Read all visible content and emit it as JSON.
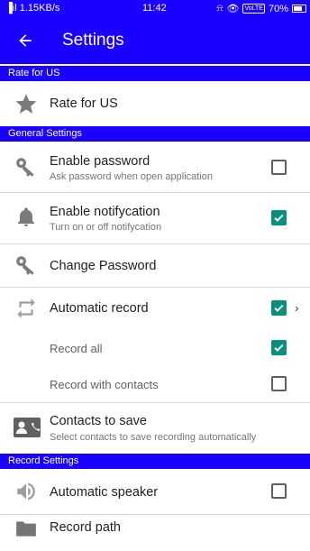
{
  "status_bar": {
    "signal": "▐il",
    "speed": "1.15KB/s",
    "time": "11:42",
    "volte": "VoLTE",
    "battery": "70%"
  },
  "app_bar": {
    "title": "Settings",
    "back_icon": "arrow-back-icon"
  },
  "sections": {
    "rate": "Rate for US",
    "general": "General Settings",
    "record": "Record Settings"
  },
  "rows": {
    "rate_us": {
      "title": "Rate for US",
      "icon": "star-icon"
    },
    "enable_password": {
      "title": "Enable password",
      "subtitle": "Ask password when open application",
      "icon": "key-icon",
      "checked": false
    },
    "enable_notification": {
      "title": "Enable notifycation",
      "subtitle": "Turn on or off notifycation",
      "icon": "bell-icon",
      "checked": true
    },
    "change_password": {
      "title": "Change Password",
      "icon": "key-icon"
    },
    "automatic_record": {
      "title": "Automatic record",
      "icon": "repeat-icon",
      "checked": true
    },
    "record_all": {
      "title": "Record all",
      "checked": true
    },
    "record_with_contacts": {
      "title": "Record with contacts",
      "checked": false
    },
    "contacts_to_save": {
      "title": "Contacts to save",
      "subtitle": "Select contacts to save recording automatically",
      "icon": "contact-card-icon"
    },
    "automatic_speaker": {
      "title": "Automatic speaker",
      "icon": "speaker-icon",
      "checked": false
    },
    "record_path": {
      "title": "Record path",
      "icon": "folder-icon"
    }
  },
  "colors": {
    "primary": "#1900ff",
    "accent": "#0a8f7e",
    "icon_gray": "#757575"
  }
}
